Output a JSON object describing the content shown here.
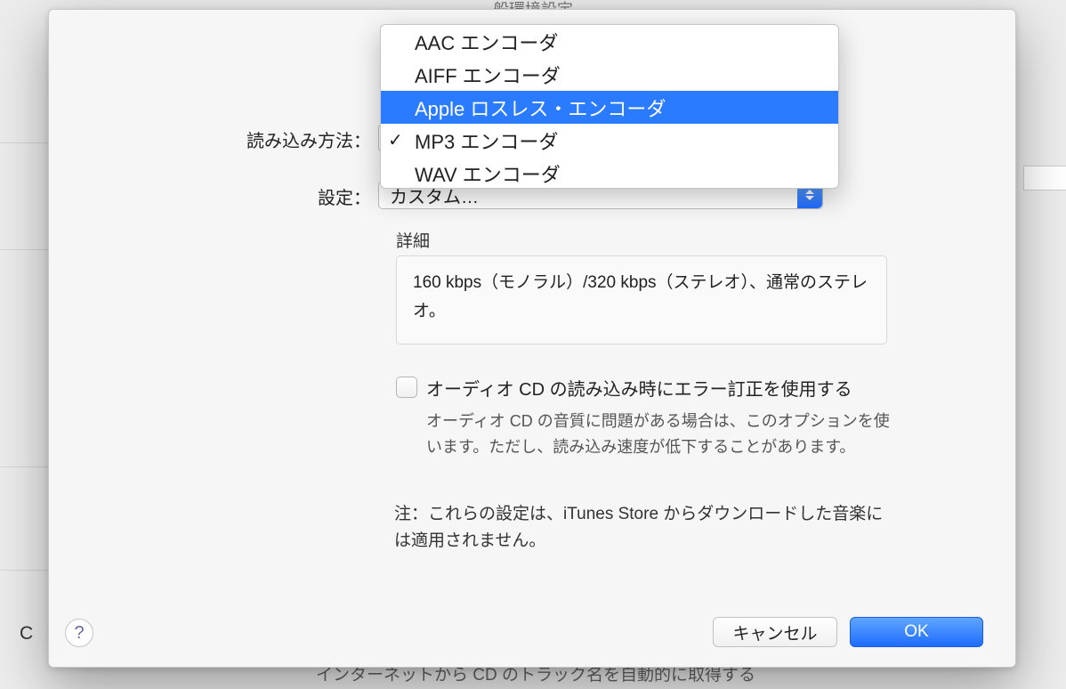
{
  "background": {
    "window_title_partial": "般環境設定",
    "left_letter": "C",
    "bottom_partial": "インターネットから CD のトラック名を自動的に取得する"
  },
  "labels": {
    "import_using": "読み込み方法：",
    "setting": "設定：",
    "details": "詳細"
  },
  "import_popup": {
    "value": "MP3 エンコーダ"
  },
  "settings_popup": {
    "value": "カスタム…"
  },
  "details_text": "160 kbps（モノラル）/320 kbps（ステレオ）、通常のステレオ。",
  "checkbox": {
    "label": "オーディオ CD の読み込み時にエラー訂正を使用する",
    "hint": "オーディオ CD の音質に問題がある場合は、このオプションを使います。ただし、読み込み速度が低下することがあります。"
  },
  "note": "注：これらの設定は、iTunes Store からダウンロードした音楽には適用されません。",
  "buttons": {
    "help": "?",
    "cancel": "キャンセル",
    "ok": "OK"
  },
  "dropdown": {
    "items": [
      {
        "label": "AAC エンコーダ",
        "selected": false,
        "checked": false
      },
      {
        "label": "AIFF エンコーダ",
        "selected": false,
        "checked": false
      },
      {
        "label": "Apple ロスレス・エンコーダ",
        "selected": true,
        "checked": false
      },
      {
        "label": "MP3 エンコーダ",
        "selected": false,
        "checked": true
      },
      {
        "label": "WAV エンコーダ",
        "selected": false,
        "checked": false
      }
    ]
  }
}
